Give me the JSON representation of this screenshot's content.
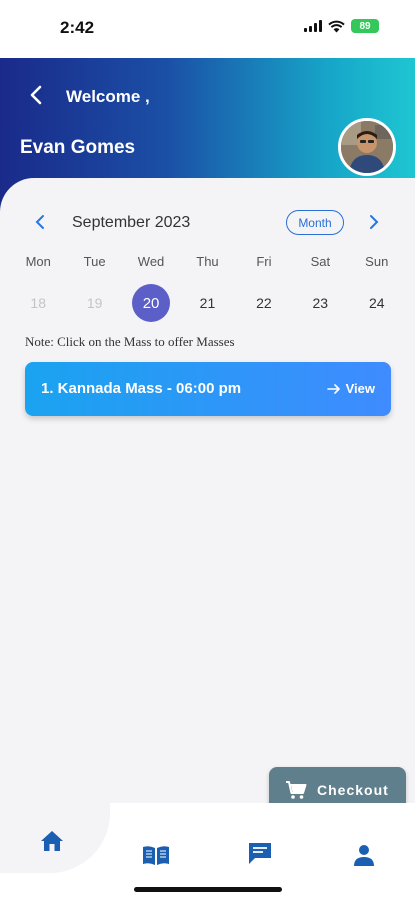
{
  "status": {
    "time": "2:42",
    "battery": "89"
  },
  "header": {
    "welcome": "Welcome ,",
    "user_name": "Evan Gomes"
  },
  "calendar": {
    "month_label": "September 2023",
    "view_toggle": "Month",
    "days": [
      {
        "name": "Mon",
        "num": "18",
        "state": "past"
      },
      {
        "name": "Tue",
        "num": "19",
        "state": "past"
      },
      {
        "name": "Wed",
        "num": "20",
        "state": "selected"
      },
      {
        "name": "Thu",
        "num": "21",
        "state": "normal"
      },
      {
        "name": "Fri",
        "num": "22",
        "state": "normal"
      },
      {
        "name": "Sat",
        "num": "23",
        "state": "normal"
      },
      {
        "name": "Sun",
        "num": "24",
        "state": "normal"
      }
    ]
  },
  "note": "Note: Click on the Mass to offer Masses",
  "masses": [
    {
      "title": "1. Kannada Mass - 06:00 pm",
      "action": "View"
    }
  ],
  "checkout": {
    "label": "Checkout"
  },
  "nav": {
    "items": [
      {
        "name": "home",
        "icon": "home-icon"
      },
      {
        "name": "book",
        "icon": "book-icon"
      },
      {
        "name": "messages",
        "icon": "chat-icon"
      },
      {
        "name": "profile",
        "icon": "person-icon"
      }
    ]
  },
  "colors": {
    "accent": "#2477e6",
    "selected_day": "#5b5fc7",
    "checkout_bg": "#5f7f8c",
    "nav_icon": "#1b5fb3"
  }
}
